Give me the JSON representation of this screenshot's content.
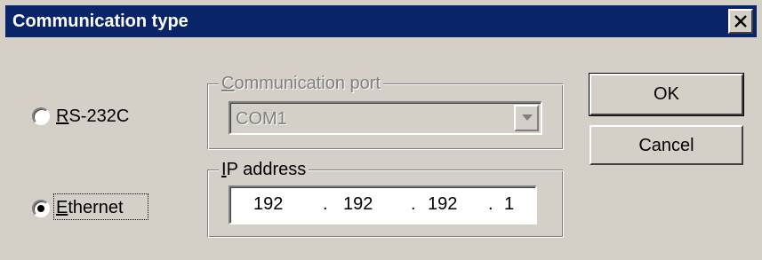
{
  "window": {
    "title": "Communication type",
    "close_glyph": "✕"
  },
  "options": [
    {
      "label_underlined": "R",
      "label_rest": "S-232C",
      "selected": false
    },
    {
      "label_underlined": "E",
      "label_rest": "thernet",
      "selected": true
    }
  ],
  "communication_port": {
    "legend_underlined": "C",
    "legend_rest": "ommunication port",
    "value": "COM1",
    "enabled": false
  },
  "ip_address": {
    "legend_underlined": "I",
    "legend_rest": "P address",
    "octets": [
      "192",
      "192",
      "192",
      "1"
    ],
    "separator": "."
  },
  "buttons": {
    "ok": "OK",
    "cancel": "Cancel"
  },
  "colors": {
    "title_bar": "#0a246a",
    "face": "#d4d0c8",
    "disabled_text": "#808080"
  },
  "icons": {
    "close": "close-icon",
    "dropdown": "dropdown-arrow-icon"
  }
}
